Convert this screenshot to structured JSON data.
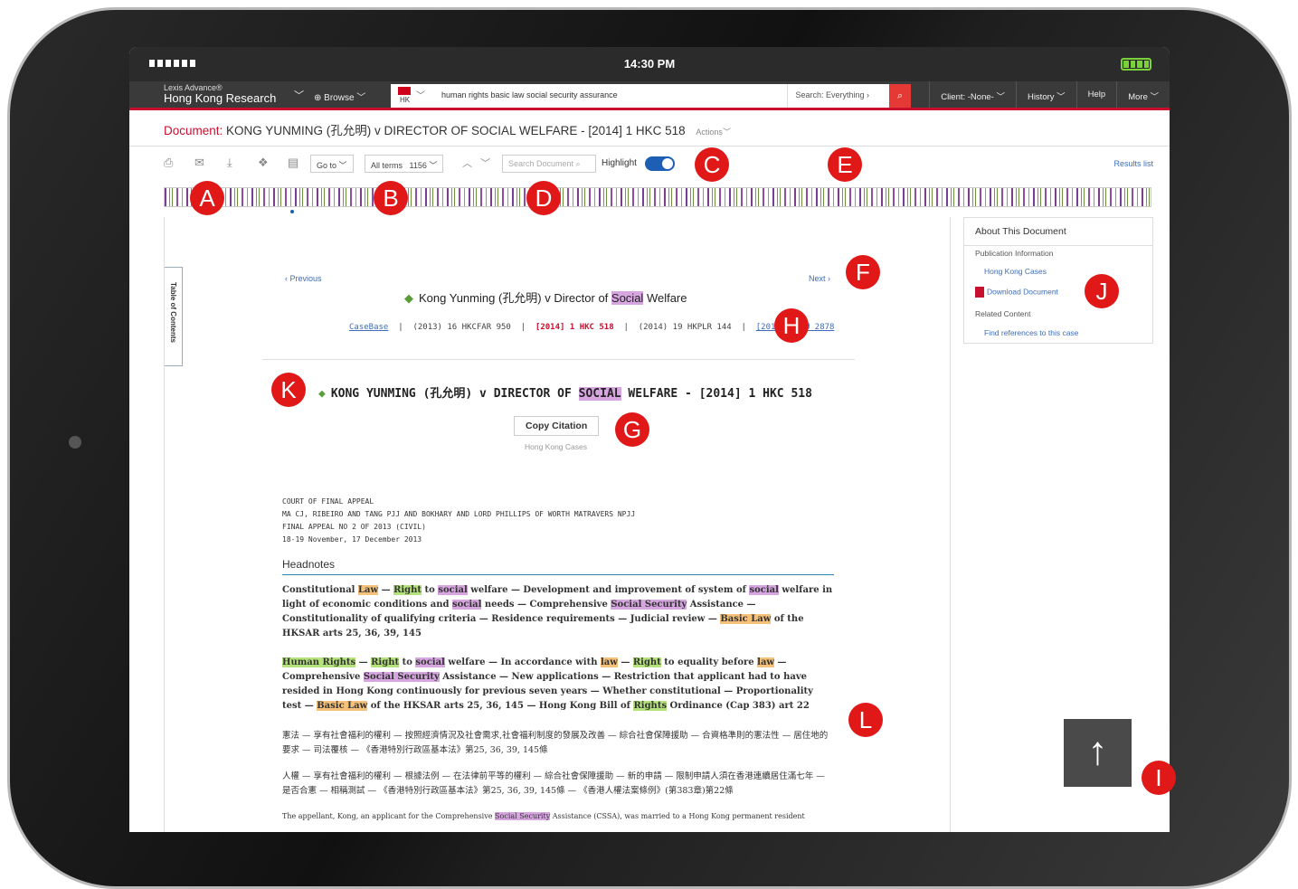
{
  "status": {
    "time": "14:30 PM"
  },
  "nav": {
    "brand_line1": "Lexis Advance®",
    "brand_line2": "Hong Kong Research",
    "browse": "Browse",
    "jurisdiction": "HK",
    "search_query": "human rights basic law social security assurance",
    "search_scope": "Search: Everything",
    "client": "Client: -None-",
    "history": "History",
    "help": "Help",
    "more": "More"
  },
  "doc": {
    "label": "Document:",
    "title": "KONG YUNMING (孔允明) v DIRECTOR OF SOCIAL WELFARE - [2014] 1 HKC 518",
    "actions": "Actions"
  },
  "toolbar": {
    "goto": "Go to",
    "allterms": "All terms",
    "term_count": "1156",
    "search_doc_placeholder": "Search Document",
    "highlight": "Highlight",
    "results_list": "Results list"
  },
  "content": {
    "toc": "Table of Contents",
    "previous": "Previous",
    "next": "Next",
    "case_title_pre": "Kong Yunming (孔允明) v Director of ",
    "case_title_hl": "Social",
    "case_title_post": " Welfare",
    "cite_casebase": "CaseBase",
    "cite1": "(2013) 16 HKCFAR 950",
    "cite2": "[2014] 1 HKC 518",
    "cite3": "(2014) 19 HKPLR 144",
    "cite4": "[2013] HKCU 2878",
    "big_pre": "KONG YUNMING (孔允明) v DIRECTOR OF ",
    "big_hl": "SOCIAL",
    "big_post": " WELFARE - [2014] 1 HKC 518",
    "copy_citation": "Copy Citation",
    "source": "Hong Kong Cases",
    "court1": "COURT OF FINAL APPEAL",
    "court2": "MA CJ, RIBEIRO AND TANG PJJ AND BOKHARY AND LORD PHILLIPS OF WORTH MATRAVERS NPJJ",
    "court3": "FINAL APPEAL NO 2 OF 2013 (CIVIL)",
    "court4": "18-19 November, 17 December 2013",
    "headnotes": "Headnotes",
    "cjk1": "憲法 — 享有社會福利的權利 — 按照經濟情況及社會需求,社會福利制度的發展及改善 — 綜合社會保障援助 — 合資格準則的憲法性 — 居住地的要求 — 司法覆核 — 《香港特別行政區基本法》第25, 36, 39, 145條",
    "cjk2": "人權 — 享有社會福利的權利 — 根據法例 — 在法律前平等的權利 — 綜合社會保障援助 — 新的申請 — 限制申請人須在香港連續居住滿七年 — 是否合憲 — 相稱測試 — 《香港特別行政區基本法》第25, 36, 39, 145條 — 《香港人權法案條例》(第383章)第22條",
    "last_pre": "The appellant, Kong, an applicant for the Comprehensive ",
    "last_hl": "Social Security",
    "last_post": " Assistance (CSSA), was married to a Hong Kong permanent resident"
  },
  "sidebar": {
    "title": "About This Document",
    "pub_info": "Publication Information",
    "hk_cases": "Hong Kong Cases",
    "download": "Download Document",
    "related": "Related Content",
    "find_refs": "Find references to this case"
  },
  "callouts": [
    "A",
    "B",
    "C",
    "D",
    "E",
    "F",
    "G",
    "H",
    "I",
    "J",
    "K",
    "L"
  ],
  "colors": {
    "accent": "#c8102e",
    "callout": "#e01818",
    "link": "#3d6dba",
    "toggle": "#1c5fb5"
  }
}
